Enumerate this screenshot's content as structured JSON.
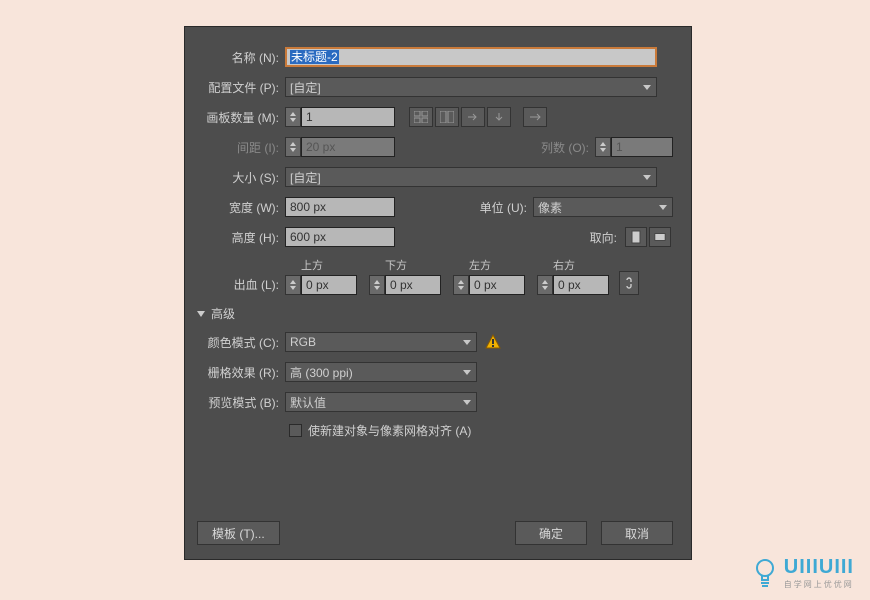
{
  "labels": {
    "name": "名称 (N):",
    "profile": "配置文件 (P):",
    "artboards": "画板数量 (M):",
    "spacing": "间距 (I):",
    "columns": "列数 (O):",
    "size": "大小 (S):",
    "width": "宽度 (W):",
    "height": "高度 (H):",
    "units": "单位 (U):",
    "orientation": "取向:",
    "bleed": "出血 (L):",
    "top": "上方",
    "bottom": "下方",
    "left": "左方",
    "right": "右方",
    "advanced": "高级",
    "colormode": "颜色模式 (C):",
    "raster": "栅格效果 (R):",
    "preview": "预览模式 (B):",
    "align_pixel": "使新建对象与像素网格对齐 (A)"
  },
  "values": {
    "name": "未标题-2",
    "profile": "[自定]",
    "artboards": "1",
    "spacing": "20 px",
    "columns": "1",
    "size": "[自定]",
    "width": "800 px",
    "height": "600 px",
    "units": "像素",
    "bleed_top": "0 px",
    "bleed_bottom": "0 px",
    "bleed_left": "0 px",
    "bleed_right": "0 px",
    "colormode": "RGB",
    "raster": "高 (300 ppi)",
    "preview": "默认值"
  },
  "buttons": {
    "templates": "模板 (T)...",
    "ok": "确定",
    "cancel": "取消"
  },
  "watermark": {
    "brand": "UIIIUIII",
    "sub": "自学网上优优网"
  }
}
